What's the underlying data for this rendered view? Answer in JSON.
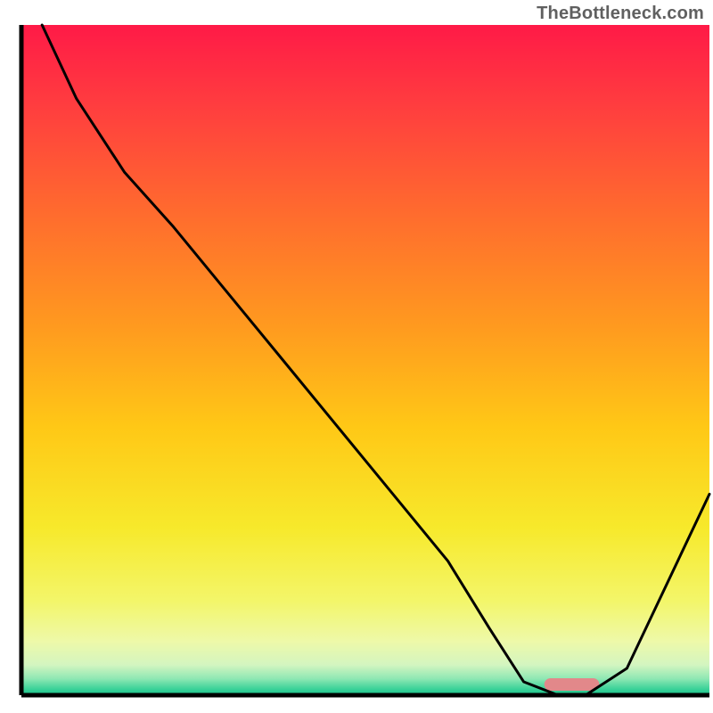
{
  "watermark": "TheBottleneck.com",
  "chart_data": {
    "type": "line",
    "title": "",
    "xlabel": "",
    "ylabel": "",
    "xlim": [
      0,
      100
    ],
    "ylim": [
      0,
      100
    ],
    "x": [
      3,
      8,
      15,
      22,
      30,
      38,
      46,
      54,
      62,
      68,
      73,
      78,
      82,
      88,
      100
    ],
    "values": [
      100,
      89,
      78,
      70,
      60,
      50,
      40,
      30,
      20,
      10,
      2,
      0,
      0,
      4,
      30
    ],
    "marker": {
      "x_range": [
        76,
        84
      ],
      "y": 1.6,
      "color": "#e2888a"
    },
    "gradient_stops": [
      {
        "offset": 0.0,
        "color": "#ff1a47"
      },
      {
        "offset": 0.12,
        "color": "#ff3d3f"
      },
      {
        "offset": 0.28,
        "color": "#ff6b2e"
      },
      {
        "offset": 0.45,
        "color": "#ff9a1f"
      },
      {
        "offset": 0.6,
        "color": "#ffc816"
      },
      {
        "offset": 0.75,
        "color": "#f7e92b"
      },
      {
        "offset": 0.86,
        "color": "#f3f66a"
      },
      {
        "offset": 0.92,
        "color": "#eef9a9"
      },
      {
        "offset": 0.955,
        "color": "#d3f5c0"
      },
      {
        "offset": 0.975,
        "color": "#90e8b4"
      },
      {
        "offset": 0.99,
        "color": "#3fd39a"
      },
      {
        "offset": 1.0,
        "color": "#17c089"
      }
    ],
    "axis_color": "#000000",
    "line_color": "#000000",
    "line_width": 3
  }
}
